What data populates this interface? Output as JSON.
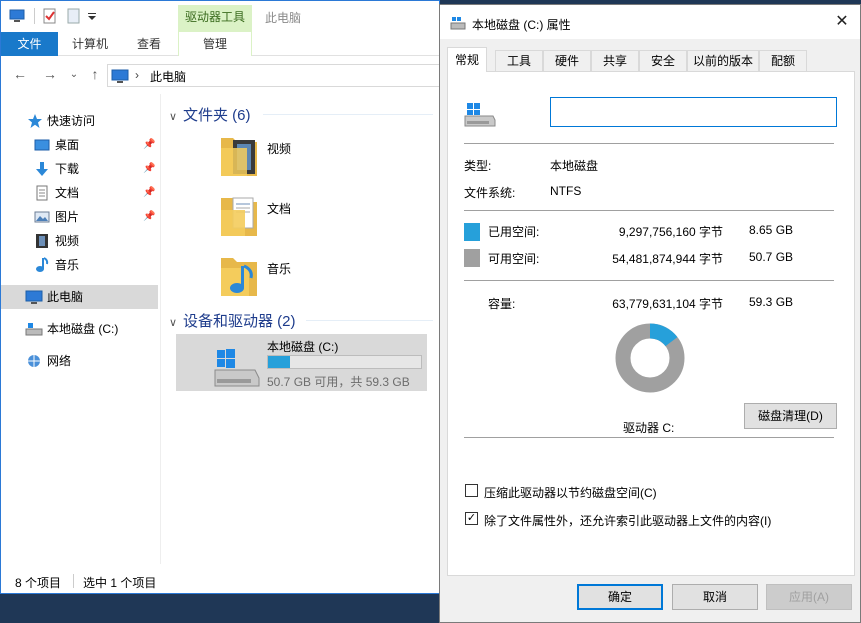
{
  "explorer": {
    "title": "此电脑",
    "contextual_tab_group": "驱动器工具",
    "ribbon_tabs": [
      "文件",
      "计算机",
      "查看",
      "管理"
    ],
    "breadcrumb": "此电脑",
    "sidebar": {
      "quick_access": "快速访问",
      "pinned": [
        "桌面",
        "下载",
        "文档",
        "图片"
      ],
      "unpinned": [
        "视频",
        "音乐"
      ],
      "this_pc": "此电脑",
      "local_disk": "本地磁盘 (C:)",
      "network": "网络"
    },
    "folders_group": "文件夹 (6)",
    "folders": [
      "视频",
      "文档",
      "音乐"
    ],
    "devices_group": "设备和驱动器 (2)",
    "drive": {
      "name": "本地磁盘 (C:)",
      "used_fraction": 0.146,
      "space_text": "50.7 GB 可用，共 59.3 GB"
    },
    "status": {
      "item_count": "8 个项目",
      "selected": "选中 1 个项目"
    }
  },
  "dialog": {
    "title": "本地磁盘 (C:) 属性",
    "tabs": [
      "常规",
      "工具",
      "硬件",
      "共享",
      "安全",
      "以前的版本",
      "配额"
    ],
    "name_value": "",
    "type_label": "类型:",
    "type_value": "本地磁盘",
    "fs_label": "文件系统:",
    "fs_value": "NTFS",
    "used": {
      "label": "已用空间:",
      "bytes": "9,297,756,160 字节",
      "size": "8.65 GB",
      "color": "#26a0da"
    },
    "free": {
      "label": "可用空间:",
      "bytes": "54,481,874,944 字节",
      "size": "50.7 GB",
      "color": "#a0a0a0"
    },
    "capacity": {
      "label": "容量:",
      "bytes": "63,779,631,104 字节",
      "size": "59.3 GB"
    },
    "drive_label": "驱动器 C:",
    "cleanup_button": "磁盘清理(D)",
    "compress_checkbox": {
      "label": "压缩此驱动器以节约磁盘空间(C)",
      "checked": false
    },
    "index_checkbox": {
      "label": "除了文件属性外，还允许索引此驱动器上文件的内容(I)",
      "checked": true
    },
    "ok_button": "确定",
    "cancel_button": "取消",
    "apply_button": "应用(A)"
  }
}
